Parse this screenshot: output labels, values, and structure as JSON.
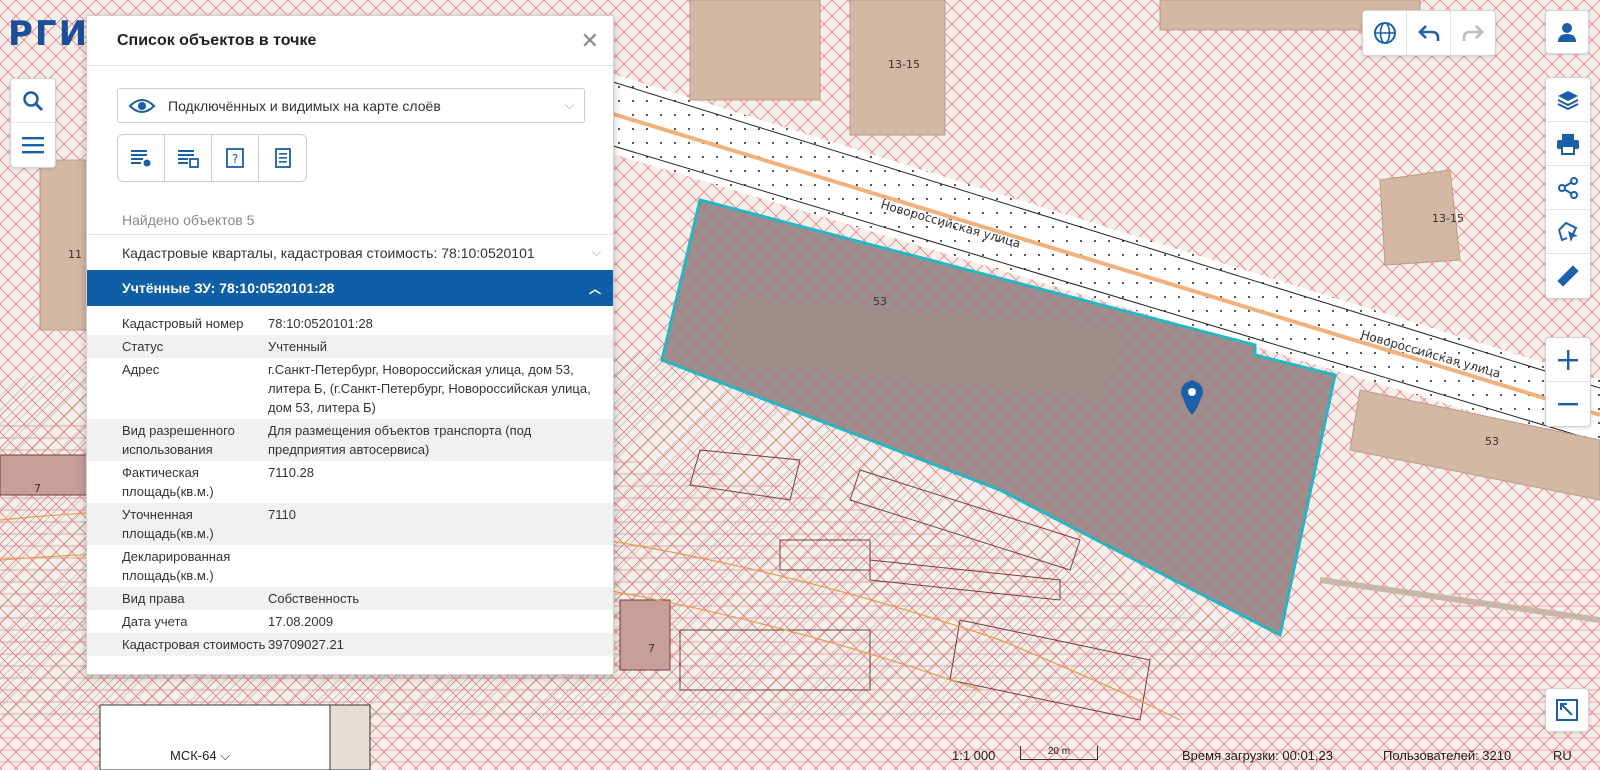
{
  "logo": "РГИ",
  "panel": {
    "title": "Список объектов в точке",
    "layer_select": "Подключённых и видимых на карте слоёв",
    "found_label": "Найдено объектов 5",
    "sections": [
      {
        "label": "Кадастровые кварталы, кадастровая стоимость: 78:10:0520101",
        "expanded": false
      },
      {
        "label": "Учтённые ЗУ: 78:10:0520101:28",
        "expanded": true
      }
    ],
    "properties": [
      {
        "key": "Кадастровый номер",
        "value": "78:10:0520101:28"
      },
      {
        "key": "Статус",
        "value": "Учтенный"
      },
      {
        "key": "Адрес",
        "value": "г.Санкт-Петербург, Новороссийская улица, дом 53, литера Б, (г.Санкт-Петербург, Новороссийская улица, дом 53, литера Б)"
      },
      {
        "key": "Вид разрешенного использования",
        "value": "Для размещения объектов транспорта (под предприятия автосервиса)"
      },
      {
        "key": "Фактическая площадь(кв.м.)",
        "value": "7110.28"
      },
      {
        "key": "Уточненная площадь(кв.м.)",
        "value": "7110"
      },
      {
        "key": "Декларированная площадь(кв.м.)",
        "value": ""
      },
      {
        "key": "Вид права",
        "value": "Собственность"
      },
      {
        "key": "Дата учета",
        "value": "17.08.2009"
      },
      {
        "key": "Кадастровая стоимость",
        "value": "39709027.21"
      }
    ]
  },
  "map": {
    "street_labels": [
      "Новороссийская улица",
      "Новороссийская улица"
    ],
    "building_labels": [
      "13-15",
      "13-15",
      "53",
      "53",
      "11",
      "7",
      "7"
    ]
  },
  "status": {
    "crs": "МСК-64",
    "scale": "1:1 000",
    "scale_bar": "20 m",
    "load_time": "Время загрузки: 00:01,23",
    "users": "Пользователей: 3210",
    "lang": "RU"
  },
  "colors": {
    "accent": "#0e5fa6",
    "parcel_fill": "#8a7e7e",
    "parcel_outline": "#1fb8c4",
    "hatch_red": "#e05a5a",
    "hatch_green": "#4bb37a"
  }
}
